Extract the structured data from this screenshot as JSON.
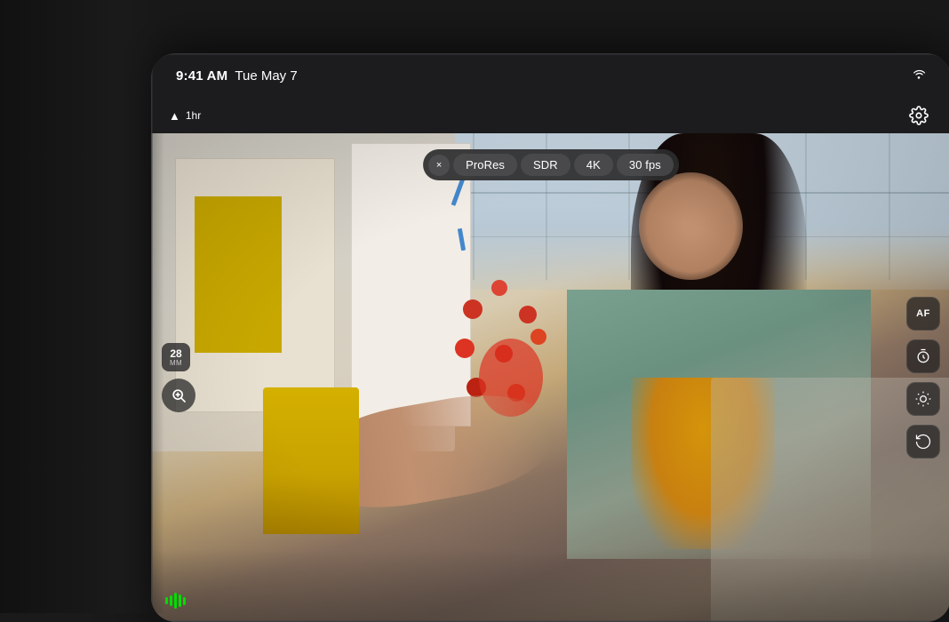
{
  "device": {
    "background_color": "#1a1a1a"
  },
  "status_bar": {
    "time": "9:41 AM",
    "date": "Tue May 7",
    "wifi_label": "wifi"
  },
  "toolbar": {
    "close_label": "×",
    "pills": [
      {
        "id": "prores",
        "label": "ProRes"
      },
      {
        "id": "sdr",
        "label": "SDR"
      },
      {
        "id": "resolution",
        "label": "4K"
      },
      {
        "id": "framerate",
        "label": "30 fps"
      }
    ],
    "settings_label": "⚙"
  },
  "left_controls": {
    "focal_length": "28",
    "focal_unit": "MM",
    "zoom_icon": "magnify"
  },
  "right_controls": [
    {
      "id": "af",
      "label": "AF"
    },
    {
      "id": "timer",
      "label": "timer"
    },
    {
      "id": "exposure",
      "label": "exposure"
    },
    {
      "id": "reset",
      "label": "reset"
    }
  ],
  "level_bars": [
    {
      "height": 8,
      "color": "#00ff00"
    },
    {
      "height": 12,
      "color": "#00ff00"
    },
    {
      "height": 16,
      "color": "#00ff00"
    },
    {
      "height": 20,
      "color": "#00ff00"
    },
    {
      "height": 14,
      "color": "#00ff00"
    }
  ]
}
